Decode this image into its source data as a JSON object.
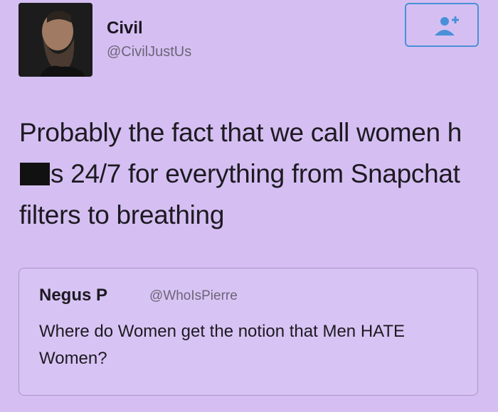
{
  "author": {
    "name": "Civil",
    "handle": "@CivilJustUs"
  },
  "tweet": {
    "text_part1": "Probably the fact that we call women h",
    "text_part2": "s 24/7 for everything from Snapchat filters to breathing"
  },
  "quoted_tweet": {
    "name": "Negus P",
    "handle": "@WhoIsPierre",
    "text": "Where do Women get the notion that Men HATE Women?"
  },
  "icons": {
    "avatar": "bearded-man-avatar",
    "follow": "follow-person-plus-icon"
  },
  "colors": {
    "background": "#d5bff2",
    "follow_accent": "#4a90d9"
  }
}
